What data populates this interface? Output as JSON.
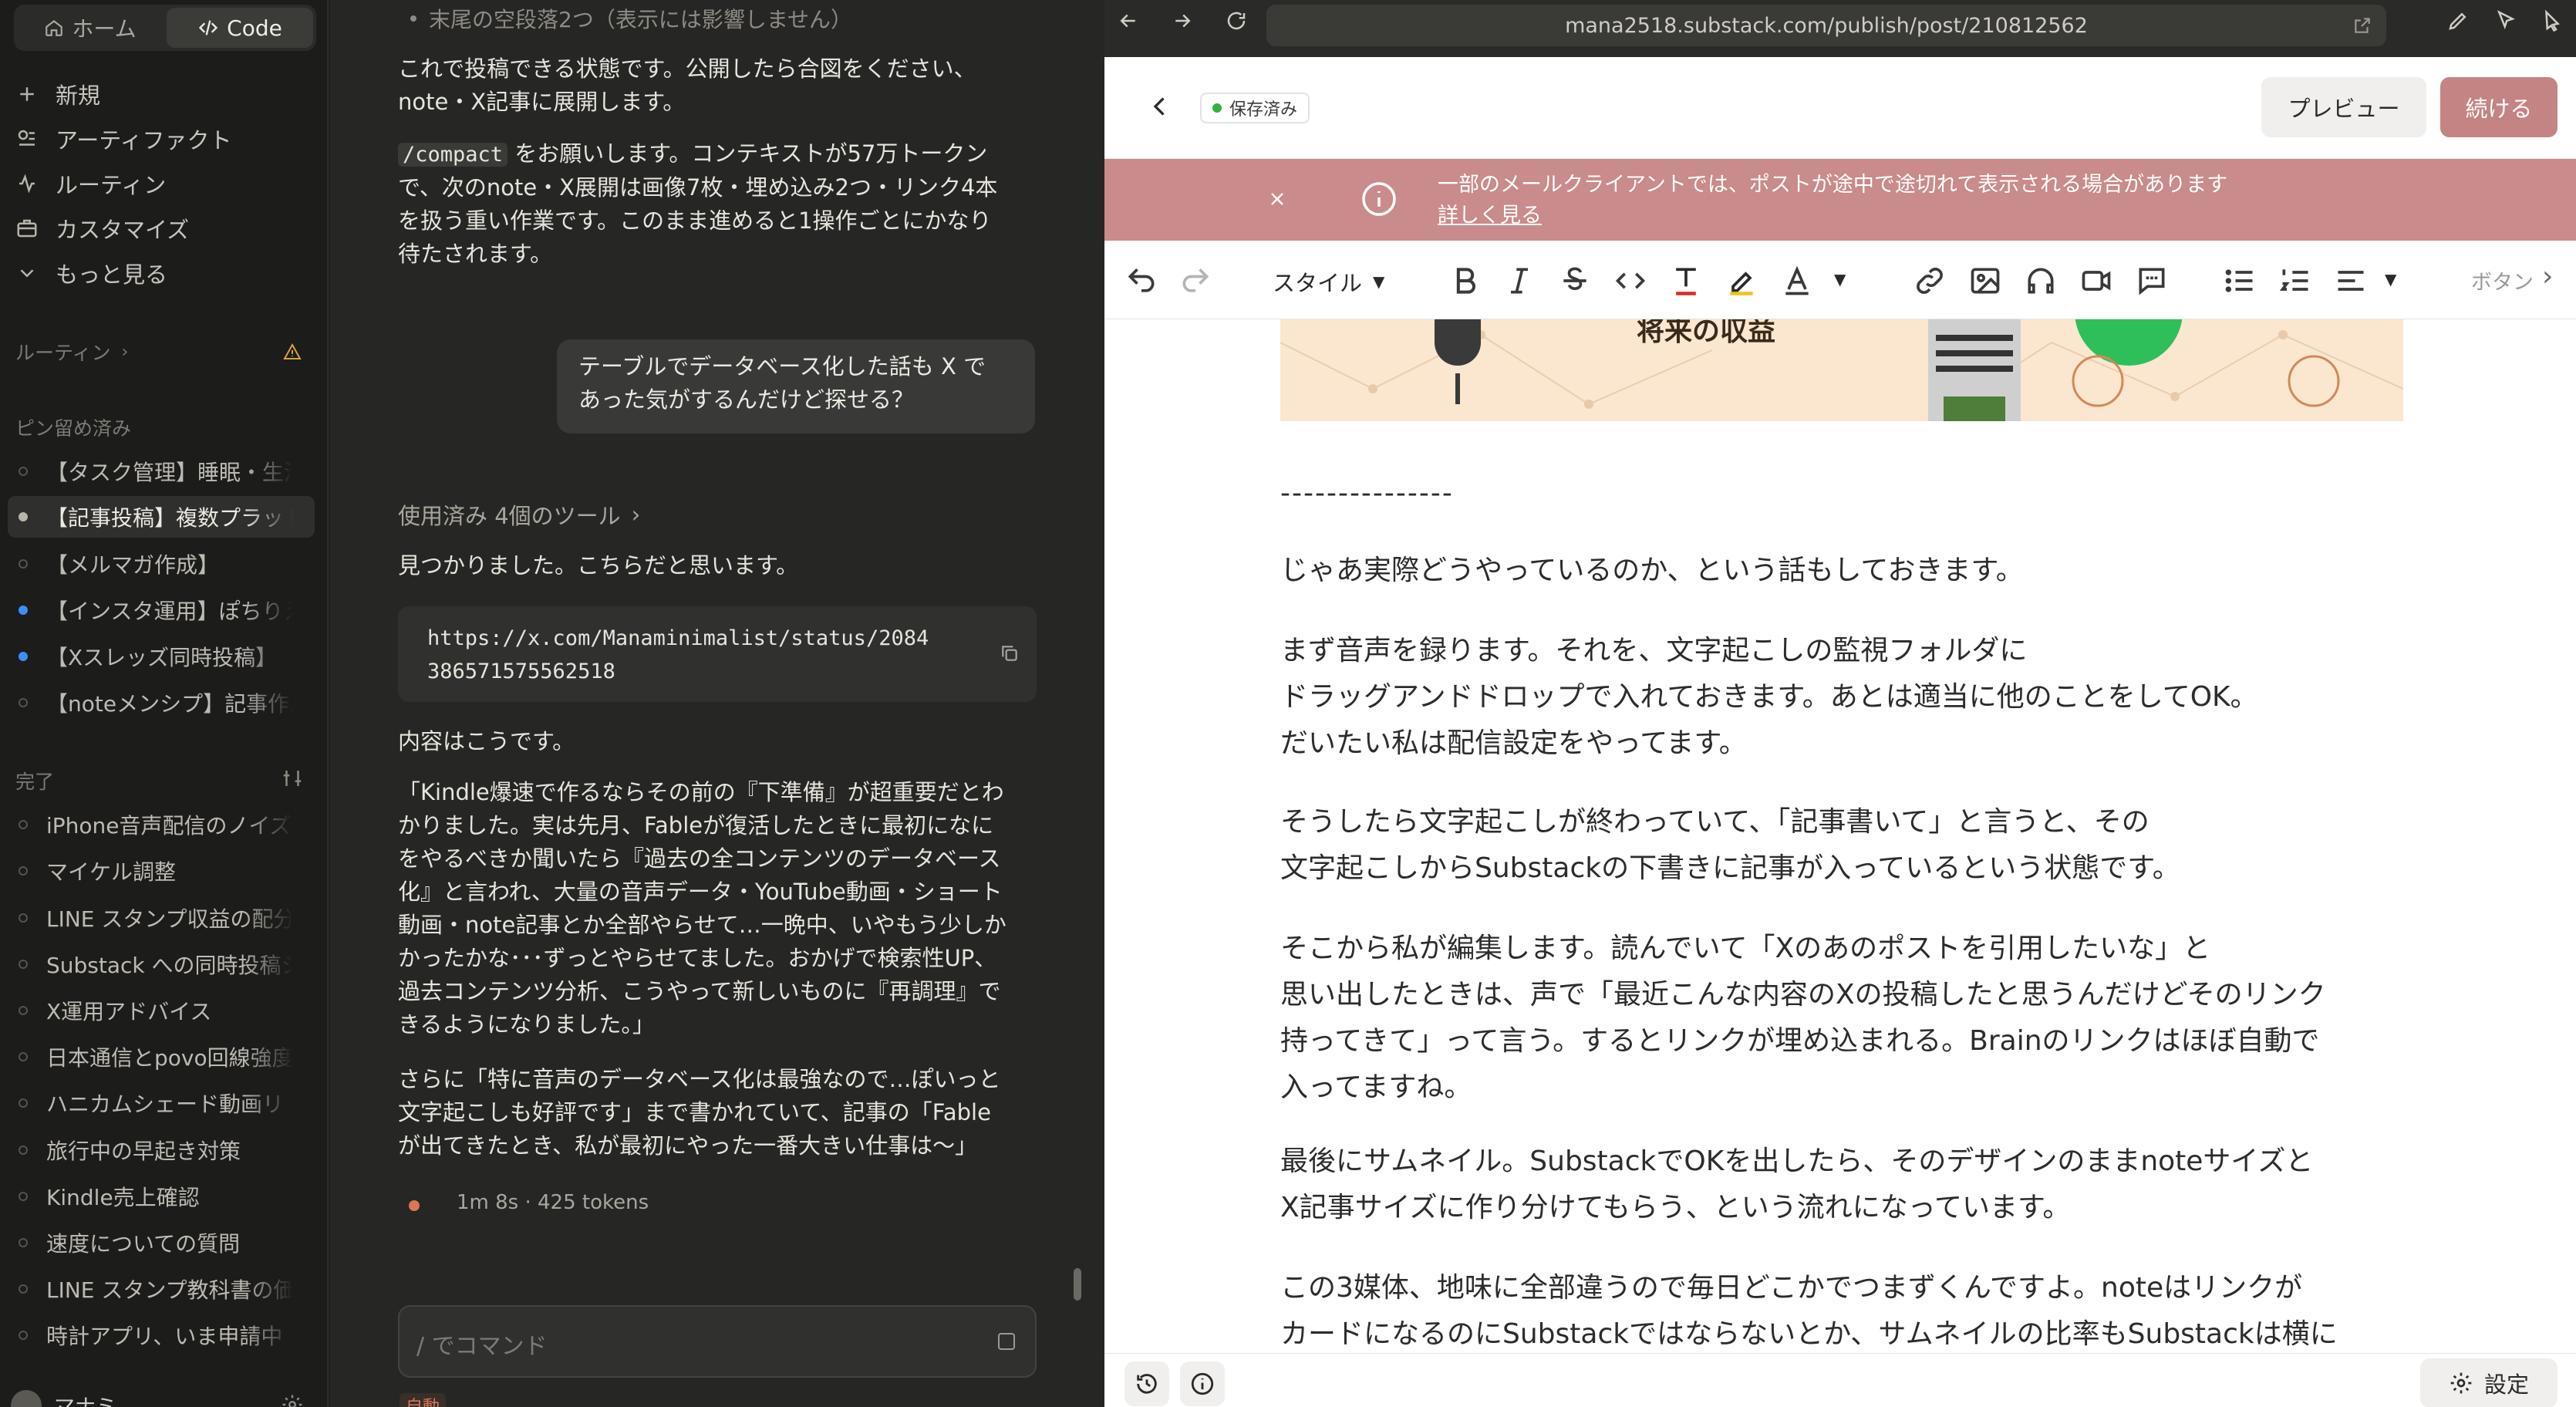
{
  "sidebar": {
    "tab_home": "ホーム",
    "tab_code": "Code",
    "nav": [
      {
        "label": "新規",
        "icon": "plus-icon"
      },
      {
        "label": "アーティファクト",
        "icon": "artifact-icon"
      },
      {
        "label": "ルーティン",
        "icon": "routine-icon"
      },
      {
        "label": "カスタマイズ",
        "icon": "briefcase-icon"
      },
      {
        "label": "もっと見る",
        "icon": "chevron-down-icon"
      }
    ],
    "routine_section": "ルーティン",
    "pinned_section": "ピン留め済み",
    "pinned": [
      {
        "label": "【タスク管理】睡眠・生活",
        "dot": "empty"
      },
      {
        "label": "【記事投稿】複数プラットフォーム",
        "dot": "white"
      },
      {
        "label": "【メルマガ作成】",
        "dot": "empty"
      },
      {
        "label": "【インスタ運用】ぽちりえ",
        "dot": "blue"
      },
      {
        "label": "【Xスレッズ同時投稿】",
        "dot": "blue"
      },
      {
        "label": "【noteメンシプ】記事作成",
        "dot": "empty"
      }
    ],
    "done_section": "完了",
    "done": [
      "iPhone音声配信のノイズ",
      "マイケル調整",
      "LINE スタンプ収益の配分",
      "Substack への同時投稿シ",
      "X運用アドバイス",
      "日本通信とpovo回線強度",
      "ハニカムシェード動画リ",
      "旅行中の早起き対策",
      "Kindle売上確認",
      "速度についての質問",
      "LINE スタンプ教科書の価",
      "時計アプリ、いま申請中"
    ],
    "user_name": "マナミ"
  },
  "chat": {
    "top_bullet": "末尾の空段落2つ（表示には影響しません）",
    "para1_line1": "これで投稿できる状態です。公開したら合図をください、",
    "para1_line2": "note・X記事に展開します。",
    "compact_code": "/compact",
    "para2_line1_rest": "をお願いします。コンテキストが57万トークン",
    "para2_line2": "で、次のnote・X展開は画像7枚・埋め込み2つ・リンク4本",
    "para2_line3": "を扱う重い作業です。このまま進めると1操作ごとにかなり",
    "para2_line4": "待たされます。",
    "user_msg_line1": "テーブルでデータベース化した話も X で",
    "user_msg_line2": "あった気がするんだけど探せる？",
    "tools_used": "使用済み 4個のツール",
    "found": "見つかりました。こちらだと思います。",
    "url_line1": "https://x.com/Manaminimalist/status/2084",
    "url_line2": "386571575562518",
    "content_intro": "内容はこうです。",
    "quote": [
      "「Kindle爆速で作るならその前の『下準備』が超重要だとわ",
      "かりました。実は先月、Fableが復活したときに最初になに",
      "をやるべきか聞いたら『過去の全コンテンツのデータベース",
      "化』と言われ、大量の音声データ・YouTube動画・ショート",
      "動画・note記事とか全部やらせて…一晩中、いやもう少しか",
      "かったかな･･･ずっとやらせてました。おかげで検索性UP、",
      "過去コンテンツ分析、こうやって新しいものに『再調理』で",
      "きるようになりました。」"
    ],
    "more": [
      "さらに「特に音声のデータベース化は最強なので…ぽいっと",
      "文字起こしも好評です」まで書かれていて、記事の「Fable",
      "が出てきたとき、私が最初にやった一番大きい仕事は〜」"
    ],
    "stats": "1m 8s · 425 tokens",
    "input_placeholder": "/ でコマンド",
    "mode_badge": "自動"
  },
  "browser": {
    "url": "mana2518.substack.com/publish/post/210812562",
    "saved_badge": "保存済み",
    "preview_btn": "プレビュー",
    "continue_btn": "続ける",
    "banner_text": "一部のメールクライアントでは、ポストが途中で途切れて表示される場合があります",
    "banner_link": "詳しく見る",
    "style_dropdown": "スタイル",
    "button_label": "ボタン",
    "banner_image_text": "将来の収益",
    "separator": "---------------",
    "paragraphs": [
      [
        "じゃあ実際どうやっているのか、という話もしておきます。"
      ],
      [
        "まず音声を録ります。それを、文字起こしの監視フォルダに",
        "ドラッグアンドドロップで入れておきます。あとは適当に他のことをしてOK。",
        "だいたい私は配信設定をやってます。"
      ],
      [
        "そうしたら文字起こしが終わっていて、「記事書いて」と言うと、その",
        "文字起こしからSubstackの下書きに記事が入っているという状態です。"
      ],
      [
        "そこから私が編集します。読んでいて「Xのあのポストを引用したいな」と",
        "思い出したときは、声で「最近こんな内容のXの投稿したと思うんだけどそのリンク",
        "持ってきて」って言う。するとリンクが埋め込まれる。Brainのリンクはほぼ自動で",
        "入ってますね。"
      ],
      [
        "最後にサムネイル。SubstackでOKを出したら、そのデザインのままnoteサイズと",
        "X記事サイズに作り分けてもらう、という流れになっています。"
      ],
      [
        "この3媒体、地味に全部違うので毎日どこかでつまずくんですよ。noteはリンクが",
        "カードになるのにSubstackではならないとか、サムネイルの比率もSubstackは横に"
      ]
    ],
    "settings_btn": "設定"
  },
  "colors": {
    "accent_orange": "#d97757",
    "banner": "#c98b8b",
    "continue": "#c48484",
    "saved_green": "#2fb344",
    "pin_blue": "#3d8ef7"
  }
}
